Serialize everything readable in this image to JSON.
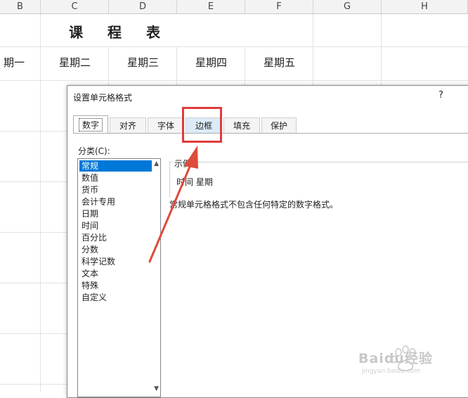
{
  "columns": [
    "B",
    "C",
    "D",
    "E",
    "F",
    "G",
    "H"
  ],
  "sheet": {
    "title": "课 程 表",
    "days": [
      "期一",
      "星期二",
      "星期三",
      "星期四",
      "星期五"
    ]
  },
  "dialog": {
    "title": "设置单元格格式",
    "help": "?",
    "tabs": [
      "数字",
      "对齐",
      "字体",
      "边框",
      "填充",
      "保护"
    ],
    "active_tab": "数字",
    "highlighted_tab": "边框",
    "category_label": "分类(C):",
    "categories": [
      "常规",
      "数值",
      "货币",
      "会计专用",
      "日期",
      "时间",
      "百分比",
      "分数",
      "科学记数",
      "文本",
      "特殊",
      "自定义"
    ],
    "selected_category": "常规",
    "sample_label": "示例",
    "sample_value": "时间 星期",
    "description": "常规单元格格式不包含任何特定的数字格式。"
  },
  "watermark": {
    "text": "Baidu经验",
    "sub": "jingyan.baidu.com"
  },
  "colors": {
    "highlight_box": "#e03b3b",
    "selection": "#0078d7",
    "tab_highlight": "#dcebf9"
  }
}
